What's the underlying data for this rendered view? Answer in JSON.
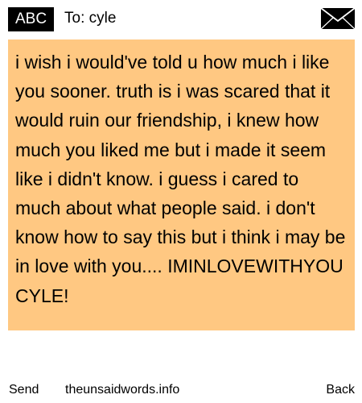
{
  "header": {
    "mode_label": "ABC",
    "recipient_label": "To: cyle",
    "envelope_icon": "envelope-icon"
  },
  "message": {
    "body": "i wish i  would've told u how much i like you sooner. truth is i was scared that it would ruin our friendship, i knew how much you liked me but i made it seem like i didn't know. i guess i cared to much about what people said. i don't know how to say this but i think i may be in love with you.... IMINLOVEWITHYOU CYLE!",
    "background_color": "#FFC882"
  },
  "footer": {
    "send_label": "Send",
    "site_label": "theunsaidwords.info",
    "back_label": "Back"
  }
}
